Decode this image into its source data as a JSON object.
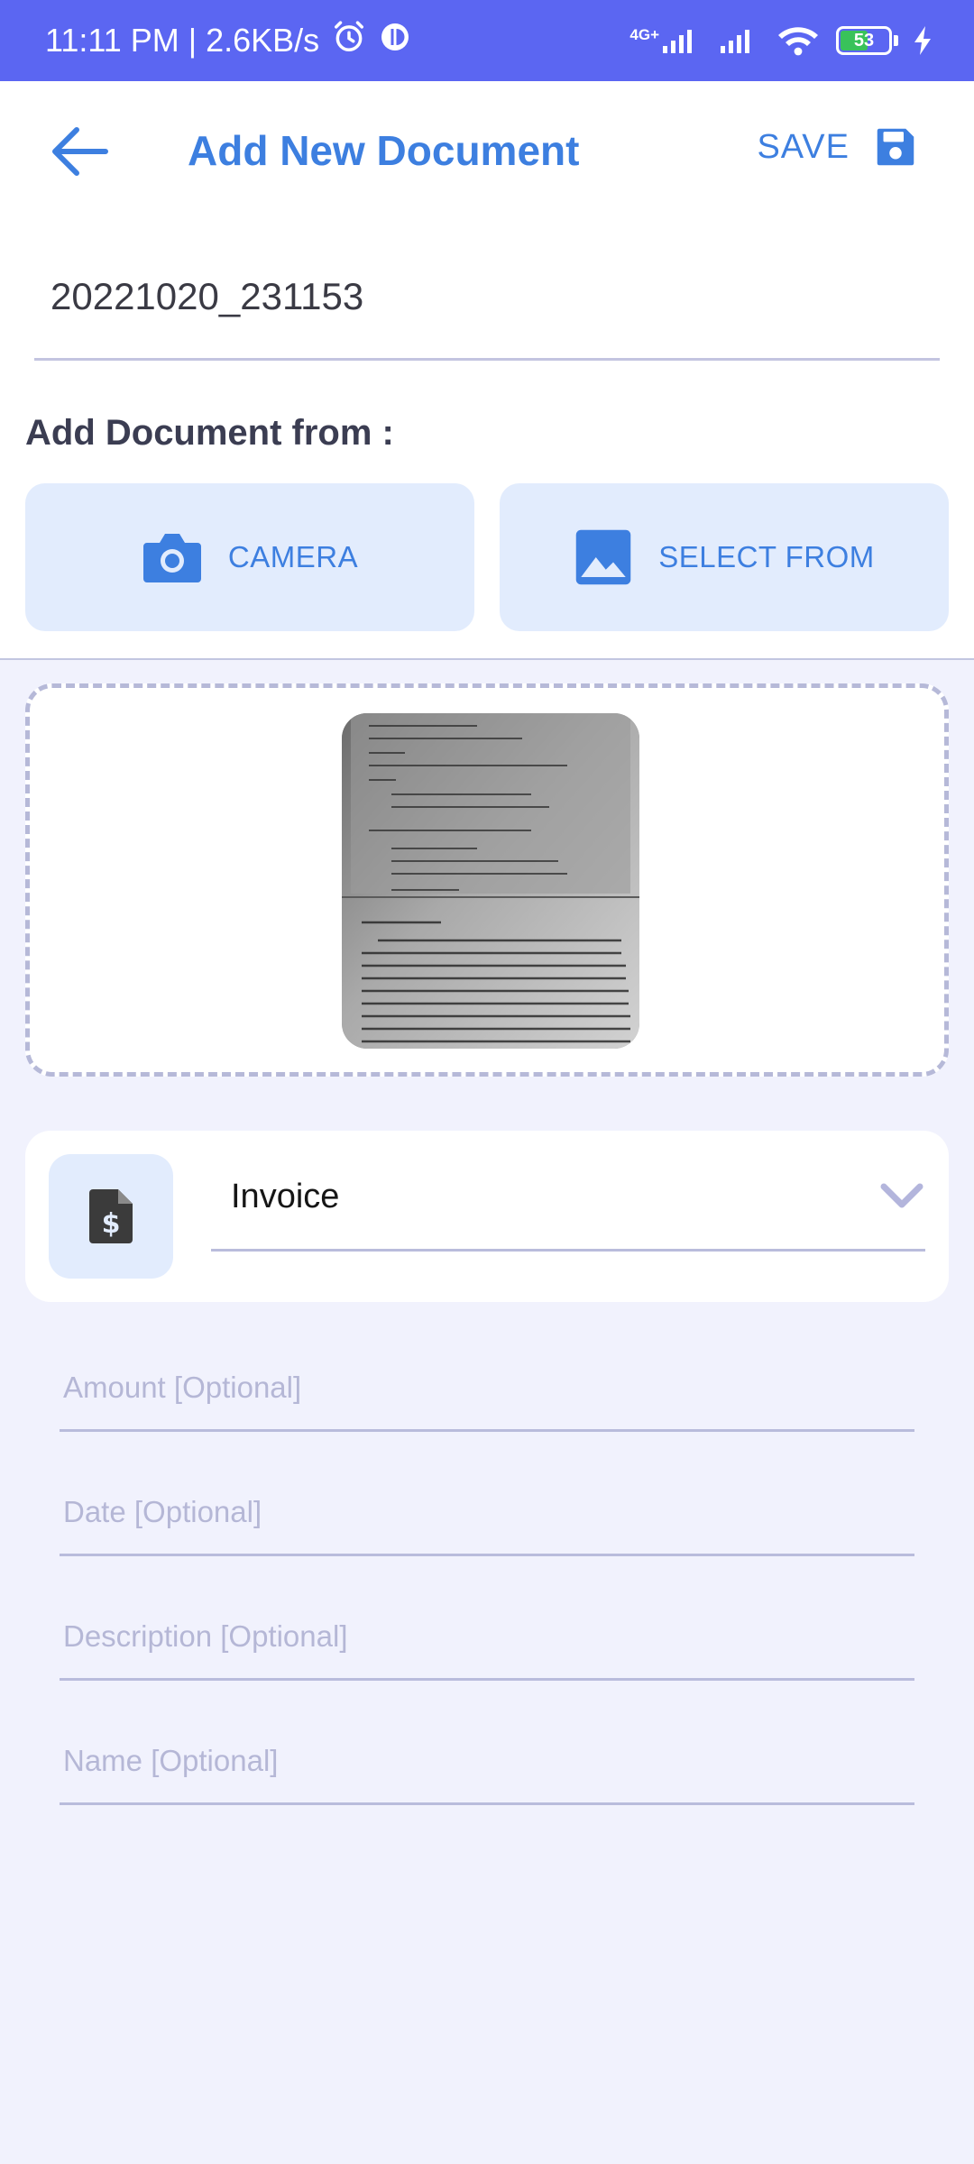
{
  "status_bar": {
    "time_speed": "11:11 PM | 2.6KB/s",
    "network_label": "4G+",
    "battery_level": "53"
  },
  "app_bar": {
    "title": "Add New Document",
    "save_label": "SAVE"
  },
  "document": {
    "name_value": "20221020_231153"
  },
  "add_from": {
    "label": "Add Document from :",
    "camera_label": "CAMERA",
    "select_label": "SELECT FROM"
  },
  "category": {
    "selected": "Invoice"
  },
  "fields": {
    "amount_placeholder": "Amount [Optional]",
    "date_placeholder": "Date [Optional]",
    "description_placeholder": "Description [Optional]",
    "name_placeholder": "Name [Optional]"
  },
  "colors": {
    "accent": "#3d7fe0",
    "status_bar": "#5b66f2",
    "background": "#f1f2fd",
    "button_bg": "#e2ecfd"
  },
  "icons": {
    "back": "arrow-left-icon",
    "save": "floppy-disk-icon",
    "camera": "camera-icon",
    "gallery": "image-icon",
    "category": "invoice-file-icon",
    "dropdown": "chevron-down-icon"
  }
}
